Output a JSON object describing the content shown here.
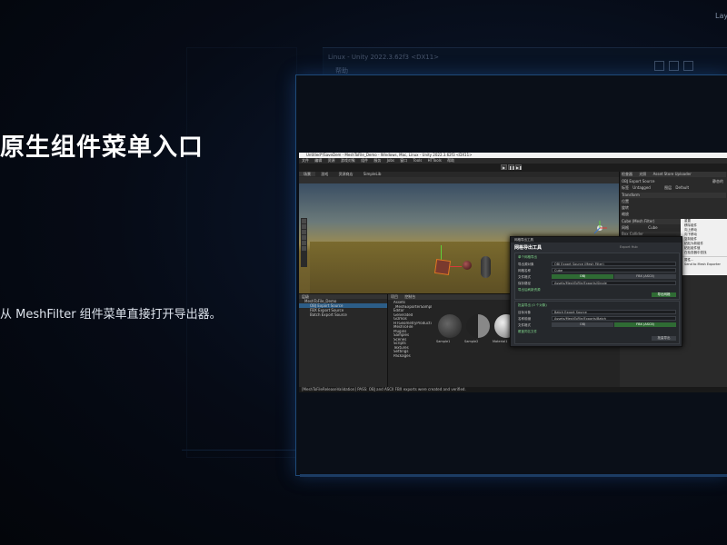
{
  "slide": {
    "title": "原生组件菜单入口",
    "subtitle": "从 MeshFilter 组件菜单直接打开导出器。"
  },
  "background_window": {
    "title": "Linux - Unity 2022.3.62f3 <DX11>",
    "menu_hint": "帮助",
    "layout_label": "Lay"
  },
  "unity": {
    "title": "Untitled*/SaveDem - MeshToFile_Demo - Windows, Mac, Linux - Unity 2022.3.62f3 <DX11>",
    "menu": [
      "文件",
      "编辑",
      "资源",
      "游戏对象",
      "组件",
      "服务",
      "Jobs",
      "窗口",
      "Tools",
      "HTTools",
      "帮助"
    ],
    "scene_tabs": [
      "场景",
      "游戏",
      "资源商店",
      "SimpleLib"
    ],
    "hierarchy_title": "层级",
    "hierarchy_items": [
      "MeshToFile_Demo",
      "OBJ Export Source",
      "FBX Export Source",
      "Batch Export Source"
    ],
    "project_tabs": [
      "项目",
      "控制台"
    ],
    "project_tree": [
      "Assets",
      "_MeshExporterSamples",
      "Editor",
      "Generated",
      "Gizmos",
      "HTGeometryProduction",
      "MeshToFile",
      "Plugins",
      "Samples",
      "Scenes",
      "Scripts",
      "Textures",
      "Settings",
      "Packages"
    ],
    "asset_labels": [
      "Sample1",
      "Sample2",
      "Material1"
    ],
    "inspector": {
      "tabs": [
        "检查器",
        "光照",
        "Asset Store Uploader"
      ],
      "object_name": "OBJ Export Source",
      "tag_label": "标签",
      "tag_value": "Untagged",
      "layer_label": "图层",
      "layer_value": "Default",
      "static_label": "静态的",
      "transform": "Transform",
      "position": "位置",
      "rotation": "旋转",
      "scale": "缩放",
      "mesh_filter": "Cube (Mesh Filter)",
      "mesh_label": "网格",
      "mesh_value": "Cube",
      "collider": "Box Collider"
    },
    "context_menu": [
      "重置",
      "移除组件",
      "向上移动",
      "向下移动",
      "复制组件",
      "粘贴为新组件",
      "粘贴组件值",
      "在检查器中查找",
      "属性...",
      "Send to Mesh Exporter"
    ],
    "dialog": {
      "bar_title": "网格导出工具",
      "header": "网格导出工具",
      "tab_hint": "Export Hub",
      "section1": "单个网格导出",
      "source_label": "导出源对象",
      "source_value": "OBJ Export Source (Mesh Filter)",
      "name_label": "网格名称",
      "name_value": "Cube",
      "format_label": "文件格式",
      "obj_btn": "OBJ",
      "fbx_btn": "FBX (ASCII)",
      "path_label": "保存路径",
      "path_value": "Assets/MeshToFile/Exports/Single",
      "check1": "导出后刷新资源",
      "export_btn": "导出网格",
      "section2": "批量导出 (0 个对象)",
      "batch_label": "目标对象",
      "batch_value": "Batch Export Source",
      "prefix_label": "名称前缀",
      "prefix_value": "Assets/MeshToFile/Exports/Batch",
      "format2_label": "文件格式",
      "check2": "覆盖同名文件",
      "batch_btn": "批量导出"
    },
    "status": "[MeshToFileReleaseValidation] PASS: OBJ and ASCII FBX exports were created and verified."
  },
  "colors": {
    "accent": "#2c5d87",
    "frame_glow": "#1f4a78",
    "export_green": "#2f6b34"
  }
}
